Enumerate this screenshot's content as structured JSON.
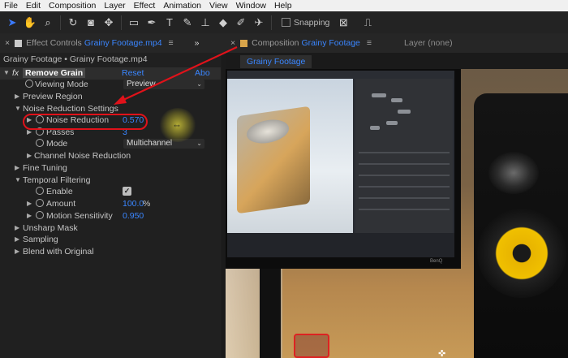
{
  "menu": [
    "File",
    "Edit",
    "Composition",
    "Layer",
    "Effect",
    "Animation",
    "View",
    "Window",
    "Help"
  ],
  "toolbar": {
    "tools": [
      {
        "icon": "selection-arrow-icon",
        "glyph": "➤"
      },
      {
        "icon": "hand-icon",
        "glyph": "✋"
      },
      {
        "icon": "zoom-icon",
        "glyph": "⌕"
      },
      {
        "icon": "rotate-icon",
        "glyph": "↻"
      },
      {
        "icon": "camera-icon",
        "glyph": "◙"
      },
      {
        "icon": "pan-behind-icon",
        "glyph": "✥"
      },
      {
        "icon": "rectangle-icon",
        "glyph": "▭"
      },
      {
        "icon": "pen-icon",
        "glyph": "✒"
      },
      {
        "icon": "type-icon",
        "glyph": "T"
      },
      {
        "icon": "brush-icon",
        "glyph": "✎"
      },
      {
        "icon": "clone-stamp-icon",
        "glyph": "⊥"
      },
      {
        "icon": "eraser-icon",
        "glyph": "◆"
      },
      {
        "icon": "roto-brush-icon",
        "glyph": "✐"
      },
      {
        "icon": "puppet-pin-icon",
        "glyph": "✈"
      }
    ],
    "snapping_label": "Snapping"
  },
  "effect_controls": {
    "tab_prefix": "Effect Controls",
    "tab_file": "Grainy Footage.mp4",
    "breadcrumb": "Grainy Footage • Grainy Footage.mp4",
    "effect_name": "Remove Grain",
    "reset": "Reset",
    "about": "Abo",
    "rows": {
      "viewing_mode": "Viewing Mode",
      "viewing_mode_value": "Preview",
      "preview_region": "Preview Region",
      "noise_reduction_settings": "Noise Reduction Settings",
      "noise_reduction": "Noise Reduction",
      "noise_reduction_value": "0.570",
      "passes": "Passes",
      "passes_value": "3",
      "mode": "Mode",
      "mode_value": "Multichannel",
      "channel_noise_reduction": "Channel Noise Reduction",
      "fine_tuning": "Fine Tuning",
      "temporal_filtering": "Temporal Filtering",
      "enable": "Enable",
      "amount": "Amount",
      "amount_value": "100.0",
      "amount_unit": "%",
      "motion_sensitivity": "Motion Sensitivity",
      "motion_sensitivity_value": "0.950",
      "unsharp_mask": "Unsharp Mask",
      "sampling": "Sampling",
      "blend_with_original": "Blend with Original"
    }
  },
  "composition": {
    "tab_prefix": "Composition",
    "tab_name": "Grainy Footage",
    "layer_tab": "Layer (none)",
    "view_tab": "Grainy Footage",
    "monitor_brand": "BenQ"
  },
  "colors": {
    "accent_blue": "#3a86ff",
    "annotation_red": "#e0121a",
    "highlight_yellow": "#e6dc3c"
  }
}
